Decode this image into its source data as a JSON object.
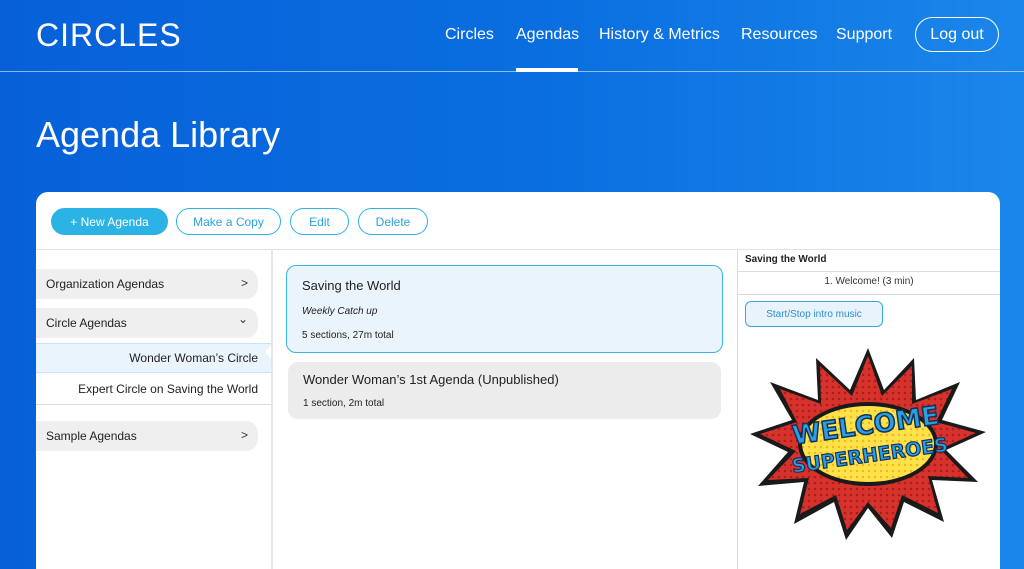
{
  "header": {
    "logo": "CIRCLES",
    "nav": [
      "Circles",
      "Agendas",
      "History & Metrics",
      "Resources",
      "Support"
    ],
    "active_nav": "Agendas",
    "logout_label": "Log out"
  },
  "page_title": "Agenda Library",
  "toolbar": {
    "new_agenda": "+ New Agenda",
    "make_copy": "Make a Copy",
    "edit": "Edit",
    "delete": "Delete"
  },
  "sidebar": {
    "organization": "Organization Agendas",
    "circle": "Circle Agendas",
    "circle_children": [
      "Wonder Woman’s Circle",
      "Expert Circle on Saving the World"
    ],
    "sample": "Sample Agendas",
    "chevron_right": ">",
    "chevron_down": "⌄"
  },
  "agendas": [
    {
      "title": "Saving the World",
      "subtitle": "Weekly Catch up",
      "meta": "5 sections, 27m total"
    },
    {
      "title": "Wonder Woman’s 1st Agenda (Unpublished)",
      "meta": "1 section, 2m total"
    }
  ],
  "detail": {
    "title": "Saving the World",
    "items": [
      "1. Welcome! (3 min)"
    ],
    "music_button": "Start/Stop intro music",
    "image_text": [
      "WELCOME",
      "SUPERHEROES"
    ]
  },
  "colors": {
    "brand_blue": "#0a6fe0",
    "accent_cyan": "#2bb3e6",
    "burst_red": "#d8322d",
    "burst_yellow": "#ffe14a",
    "text_blue": "#2ba0e0"
  }
}
